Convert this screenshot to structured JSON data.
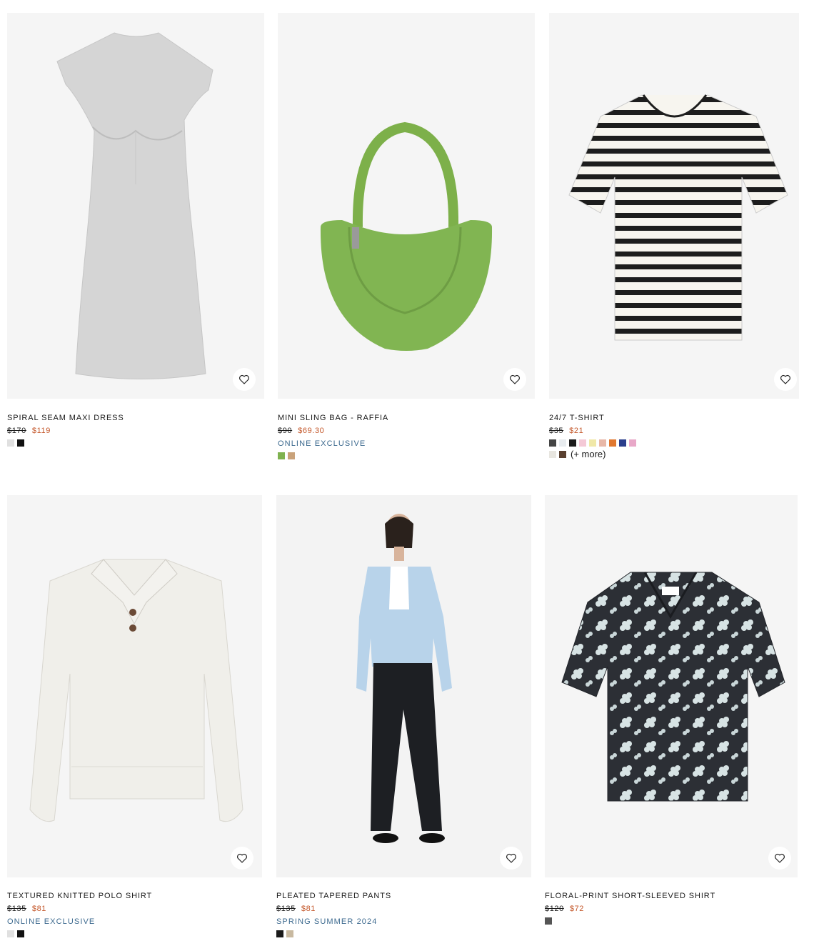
{
  "products": [
    {
      "name": "SPIRAL SEAM MAXI DRESS",
      "old_price": "$170",
      "price": "$119",
      "tag": "",
      "swatches": [
        "#e0e0e0",
        "#111111"
      ],
      "more": ""
    },
    {
      "name": "MINI SLING BAG - RAFFIA",
      "old_price": "$90",
      "price": "$69.30",
      "tag": "ONLINE EXCLUSIVE",
      "swatches": [
        "#7fb24f",
        "#c9a27a"
      ],
      "more": ""
    },
    {
      "name": "24/7 T-SHIRT",
      "old_price": "$35",
      "price": "$21",
      "tag": "",
      "swatches": [
        "#444444",
        "#e8ecef",
        "#1c1c1c",
        "#f4c9d6",
        "#f0e8a8",
        "#e8b8a8",
        "#e07830",
        "#2b3f8c",
        "#e8a8c8",
        "#e8e6e0",
        "#5a4030"
      ],
      "more": "(+ more)"
    },
    {
      "name": "TEXTURED KNITTED POLO SHIRT",
      "old_price": "$135",
      "price": "$81",
      "tag": "ONLINE EXCLUSIVE",
      "swatches": [
        "#e0e0e0",
        "#111111"
      ],
      "more": ""
    },
    {
      "name": "PLEATED TAPERED PANTS",
      "old_price": "$135",
      "price": "$81",
      "tag": "SPRING SUMMER 2024",
      "swatches": [
        "#1a1a1a",
        "#c8b9a0"
      ],
      "more": ""
    },
    {
      "name": "FLORAL-PRINT SHORT-SLEEVED SHIRT",
      "old_price": "$120",
      "price": "$72",
      "tag": "",
      "swatches": [
        "#555555"
      ],
      "more": ""
    }
  ]
}
